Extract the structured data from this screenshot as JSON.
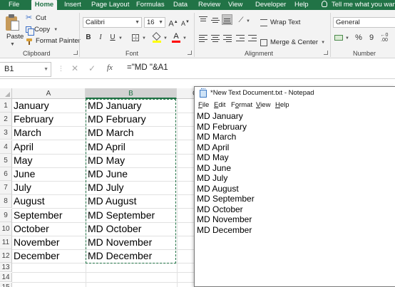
{
  "ribbon_tabs": [
    {
      "label": "File",
      "active": false
    },
    {
      "label": "Home",
      "active": true
    },
    {
      "label": "Insert",
      "active": false
    },
    {
      "label": "Page Layout",
      "active": false
    },
    {
      "label": "Formulas",
      "active": false
    },
    {
      "label": "Data",
      "active": false
    },
    {
      "label": "Review",
      "active": false
    },
    {
      "label": "View",
      "active": false
    },
    {
      "label": "Developer",
      "active": false
    },
    {
      "label": "Help",
      "active": false
    }
  ],
  "tell_me": "Tell me what you want t",
  "clipboard": {
    "paste": "Paste",
    "cut": "Cut",
    "copy": "Copy",
    "format_painter": "Format Painter",
    "group_label": "Clipboard"
  },
  "font": {
    "name": "Calibri",
    "size": "16",
    "bold": "B",
    "italic": "I",
    "underline": "U",
    "group_label": "Font"
  },
  "alignment": {
    "wrap_text": "Wrap Text",
    "merge_center": "Merge & Center",
    "group_label": "Alignment"
  },
  "number": {
    "format": "General",
    "group_label": "Number",
    "percent": "%",
    "comma": "9"
  },
  "formula_bar": {
    "name_box": "B1",
    "fx": "fx",
    "formula": "=\"MD \"&A1"
  },
  "grid": {
    "columns": [
      "A",
      "B",
      "C"
    ],
    "rows": [
      {
        "num": "1",
        "a": "January",
        "b": "MD January"
      },
      {
        "num": "2",
        "a": "February",
        "b": "MD February"
      },
      {
        "num": "3",
        "a": "March",
        "b": "MD March"
      },
      {
        "num": "4",
        "a": "April",
        "b": "MD April"
      },
      {
        "num": "5",
        "a": "May",
        "b": "MD May"
      },
      {
        "num": "6",
        "a": "June",
        "b": "MD June"
      },
      {
        "num": "7",
        "a": "July",
        "b": "MD July"
      },
      {
        "num": "8",
        "a": "August",
        "b": "MD August"
      },
      {
        "num": "9",
        "a": "September",
        "b": "MD September"
      },
      {
        "num": "10",
        "a": "October",
        "b": "MD October"
      },
      {
        "num": "11",
        "a": "November",
        "b": "MD November"
      },
      {
        "num": "12",
        "a": "December",
        "b": "MD December"
      }
    ],
    "extra_rows": [
      "13",
      "14",
      "15"
    ]
  },
  "notepad": {
    "title": "*New Text Document.txt - Notepad",
    "menu": {
      "file": [
        "F",
        "ile"
      ],
      "edit": [
        "E",
        "dit"
      ],
      "format": [
        "F",
        "o",
        "rmat"
      ],
      "view": [
        "V",
        "iew"
      ],
      "help": [
        "H",
        "elp"
      ]
    },
    "lines": [
      "MD January",
      "MD February",
      "MD March",
      "MD April",
      "MD May",
      "MD June",
      "MD July",
      "MD August",
      "MD September",
      "MD October",
      "MD November",
      "MD December"
    ]
  },
  "colors": {
    "excel_green": "#217346",
    "ribbon_bg": "#f3f3f3"
  }
}
